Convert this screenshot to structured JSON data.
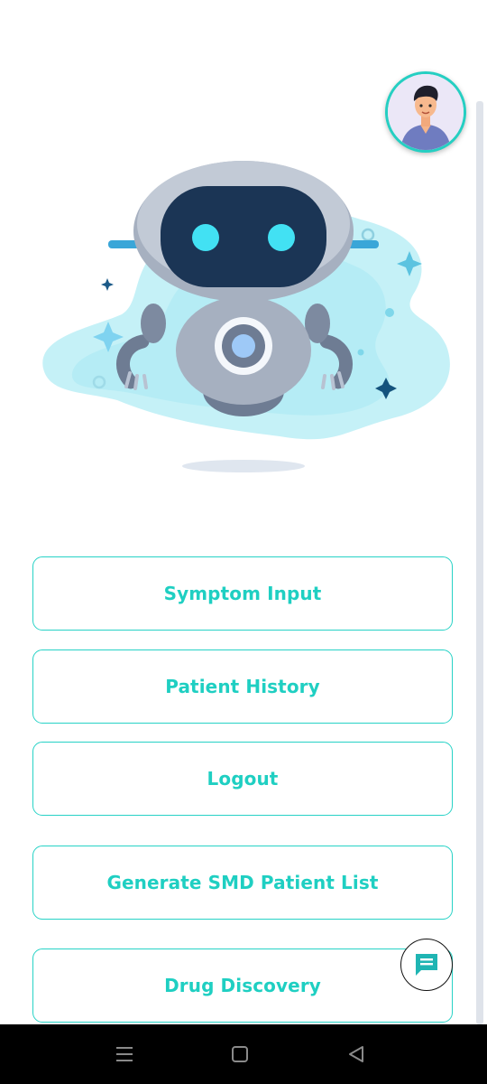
{
  "menu": {
    "items": [
      {
        "label": "Symptom Input"
      },
      {
        "label": "Patient History"
      },
      {
        "label": "Logout"
      },
      {
        "label": "Generate SMD Patient List"
      },
      {
        "label": "Drug Discovery"
      }
    ]
  },
  "icons": {
    "avatar": "user-avatar-icon",
    "hero": "robot-illustration",
    "chat": "chat-icon",
    "nav_menu": "menu-icon",
    "nav_home": "home-icon",
    "nav_back": "back-icon"
  },
  "colors": {
    "accent": "#1fcfc2",
    "chat_icon": "#1fb5b3",
    "nav_bar": "#000000"
  }
}
